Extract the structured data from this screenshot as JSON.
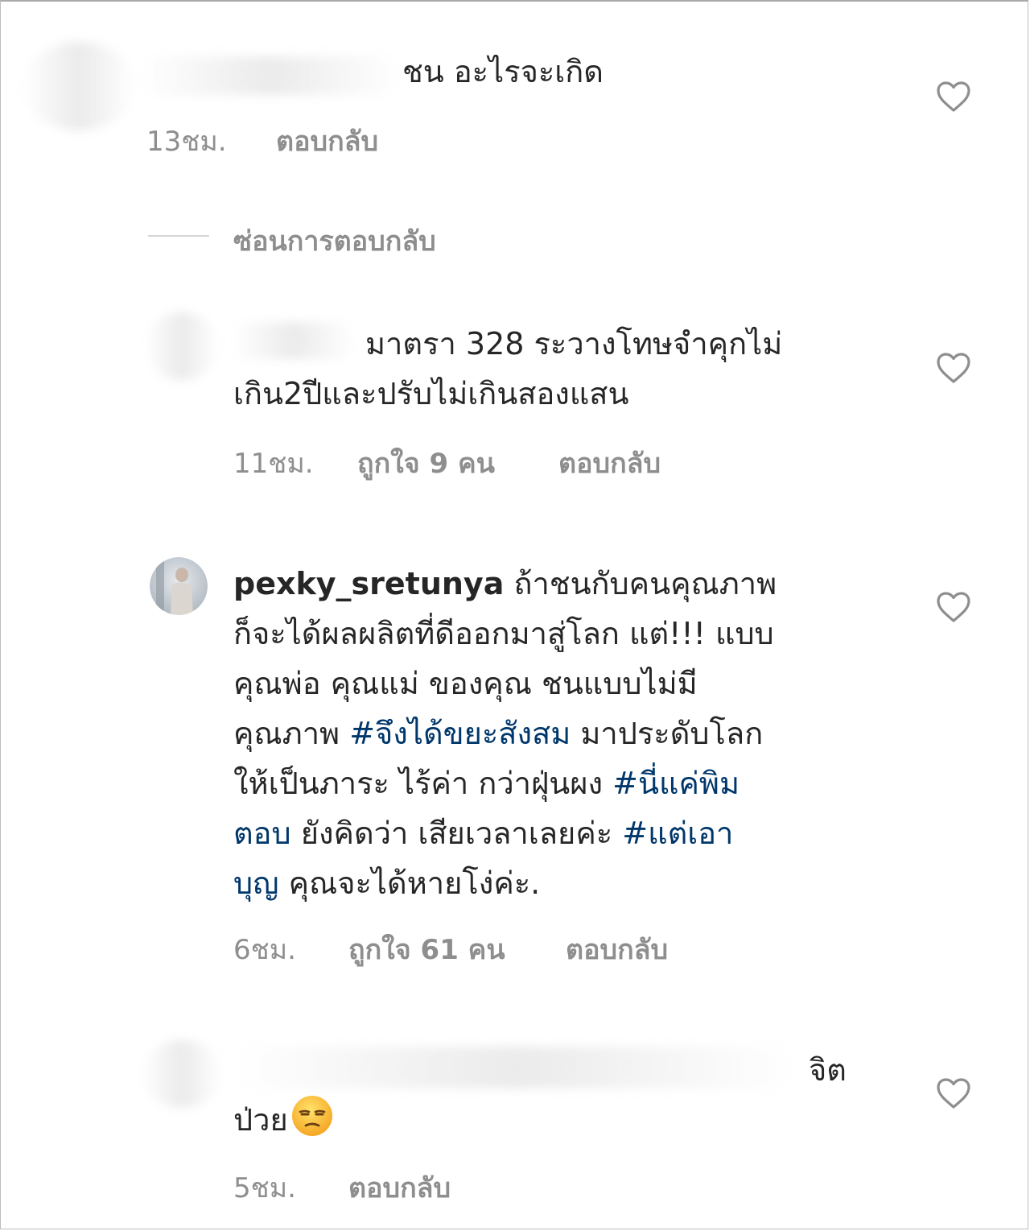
{
  "comments": [
    {
      "text": "ชน  อะไรจะเกิด",
      "time": "13ชม.",
      "reply": "ตอบกลับ"
    },
    {
      "lines": [
        "มาตรา 328 ระวางโทษจำคุกไม่",
        "เกิน2ปีและปรับไม่เกินสองแสน"
      ],
      "time": "11ชม.",
      "likes": "ถูกใจ 9 คน",
      "reply": "ตอบกลับ"
    },
    {
      "username": "pexky_sretunya",
      "line1": "ถ้าชนกับคนคุณภาพ",
      "line2": "ก็จะได้ผลผลิตที่ดีออกมาสู่โลก แต่!!! แบบ",
      "line3": "คุณพ่อ คุณแม่ ของคุณ ชนแบบไม่มี",
      "line4_a": "คุณภาพ ",
      "line4_tag": "#จึงได้ขยะสังสม",
      "line4_b": " มาประดับโลก",
      "line5_a": "ให้เป็นภาระ ไร้ค่า กว่าฝุ่นผง  ",
      "line5_tag": "#นี่แค่พิม",
      "line6_tag": "ตอบ",
      "line6_a": " ยังคิดว่า เสียเวลาเลยค่ะ ",
      "line6_tag2": "#แต่เอา",
      "line7_tag": "บุญ",
      "line7_a": " คุณจะได้หายโง่ค่ะ.",
      "time": "6ชม.",
      "likes": "ถูกใจ 61 คน",
      "reply": "ตอบกลับ"
    },
    {
      "line1": "จิต",
      "line2": "ป่วย",
      "emoji": "unamused-face-icon",
      "time": "5ชม.",
      "reply": "ตอบกลับ"
    }
  ],
  "hide_replies": "ซ่อนการตอบกลับ",
  "colors": {
    "text": "#262626",
    "meta": "#8e8e8e",
    "hashtag": "#00376b",
    "heart": "#8e8e8e"
  }
}
